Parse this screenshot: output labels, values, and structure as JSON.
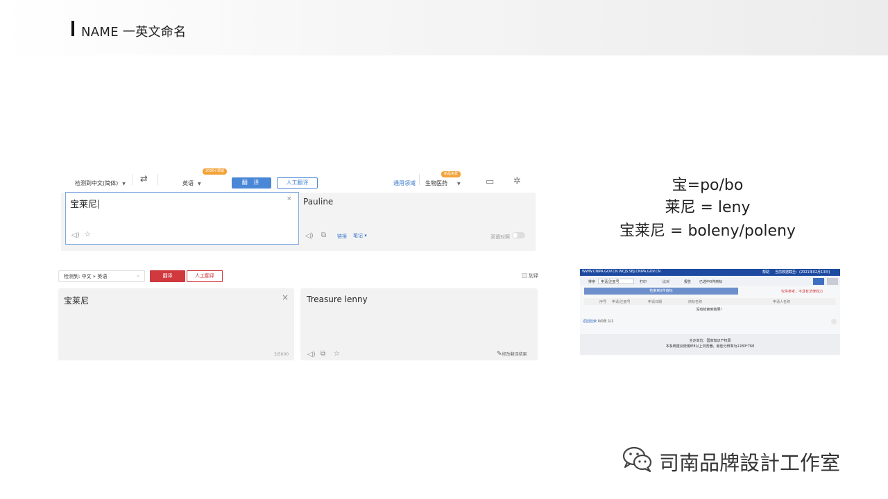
{
  "header": {
    "title": "NAME 一英文命名"
  },
  "translator_a": {
    "source_lang": "检测到中文(简体)",
    "target_lang": "英语",
    "badge_left": "2000+领域",
    "badge_right": "新品免费",
    "translate_button": "翻  译",
    "human_button": "人工翻译",
    "domain_link": "通用领域",
    "domain_value": "生物医药",
    "source_text": "宝莱尼",
    "target_text": "Pauline",
    "actions": {
      "link": "链接",
      "note": "笔记 ▾"
    },
    "toggle_label": "双语对照"
  },
  "translator_b": {
    "lang_select": "检测到: 中文 » 英语",
    "translate_button": "翻译",
    "human_button": "人工翻译",
    "checkbox_label": "划译",
    "source_text": "宝莱尼",
    "target_text": "Treasure lenny",
    "char_count": "3/5000",
    "edit_label": "修改翻译结果"
  },
  "rules": [
    "宝=po/bo",
    "莱尼 = leny",
    "宝莱尼 = boleny/poleny"
  ],
  "cnipa": {
    "site": "WWW.CNIPA.GOV.CN WCJS.SBJ.CNIPA.GOV.CN",
    "help": "帮助",
    "date": "当前数据截至：(2021年02月13日)",
    "sort": "排序",
    "sort_value": "申请/注册号",
    "print": "打印",
    "compare": "比对",
    "report": "报告",
    "selected": "已选中0件商标",
    "banner": "检索到0件商标",
    "warning": "仅供参考，不具有法律效力",
    "columns": [
      "序号",
      "申请/注册号",
      "申请日期",
      "商标名称",
      "申请人名称"
    ],
    "message": "没有检索到结果！",
    "pagination": "返回检索",
    "pagination_count": "0/0页  1/1",
    "footer_1": "主办单位：国家知识产权局",
    "footer_2": "本系统建议使用IE8以上浏览器，最佳分辨率为1280*768"
  },
  "watermark": "司南品牌設計工作室"
}
